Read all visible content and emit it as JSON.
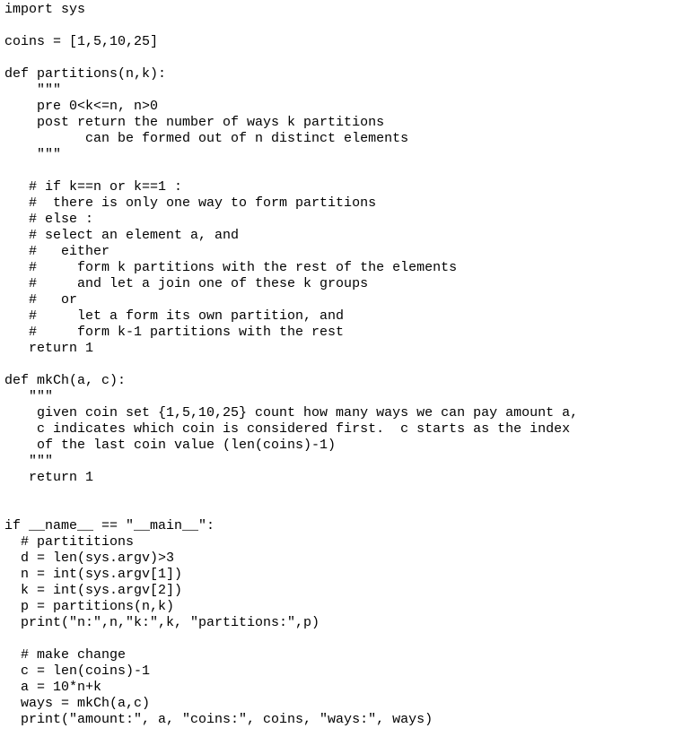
{
  "document": {
    "type": "python-source",
    "lines": [
      "import sys",
      "",
      "coins = [1,5,10,25]",
      "",
      "def partitions(n,k):",
      "    \"\"\"",
      "    pre 0<k<=n, n>0",
      "    post return the number of ways k partitions",
      "          can be formed out of n distinct elements",
      "    \"\"\"",
      "",
      "   # if k==n or k==1 :",
      "   #  there is only one way to form partitions",
      "   # else :",
      "   # select an element a, and",
      "   #   either",
      "   #     form k partitions with the rest of the elements",
      "   #     and let a join one of these k groups",
      "   #   or",
      "   #     let a form its own partition, and",
      "   #     form k-1 partitions with the rest",
      "   return 1",
      "",
      "def mkCh(a, c):",
      "   \"\"\"",
      "    given coin set {1,5,10,25} count how many ways we can pay amount a,",
      "    c indicates which coin is considered first.  c starts as the index",
      "    of the last coin value (len(coins)-1)",
      "   \"\"\"",
      "   return 1",
      "",
      "",
      "if __name__ == \"__main__\":",
      "  # partititions",
      "  d = len(sys.argv)>3",
      "  n = int(sys.argv[1])",
      "  k = int(sys.argv[2])",
      "  p = partitions(n,k)",
      "  print(\"n:\",n,\"k:\",k, \"partitions:\",p)",
      "",
      "  # make change",
      "  c = len(coins)-1",
      "  a = 10*n+k",
      "  ways = mkCh(a,c)",
      "  print(\"amount:\", a, \"coins:\", coins, \"ways:\", ways)"
    ]
  }
}
